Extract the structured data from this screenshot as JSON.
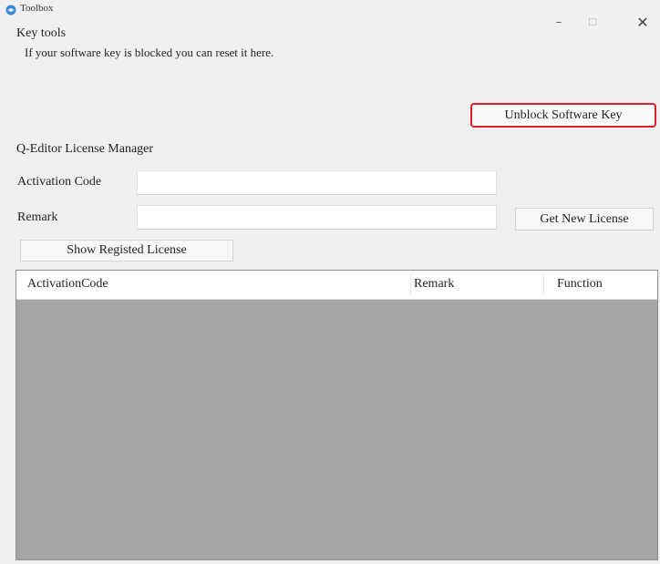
{
  "window": {
    "title": "Toolbox",
    "minimize_glyph": "–",
    "maximize_glyph": "☐",
    "close_glyph": "✕"
  },
  "key_tools": {
    "title": "Key tools",
    "description": "If your software key is blocked you can reset it here.",
    "unblock_button": "Unblock Software Key",
    "highlight_color": "#d6212b"
  },
  "license_manager": {
    "title": "Q-Editor License Manager",
    "activation_label": "Activation Code",
    "activation_value": "",
    "remark_label": "Remark",
    "remark_value": "",
    "get_license_button": "Get New License",
    "show_button": "Show Registed License"
  },
  "license_table": {
    "columns": [
      "ActivationCode",
      "Remark",
      "Function"
    ],
    "rows": [],
    "empty_background": "#a5a5a5"
  },
  "icons": {
    "app": "globe-gear-icon"
  }
}
